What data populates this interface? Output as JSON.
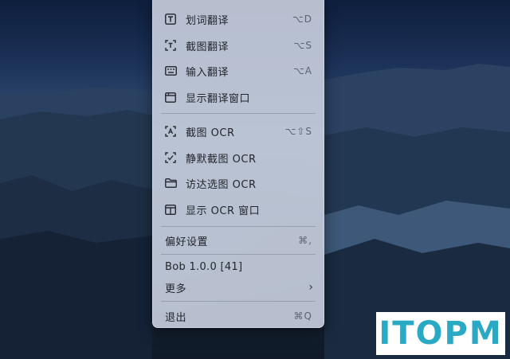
{
  "menu": {
    "items": [
      {
        "label": "划词翻译",
        "shortcut": "⌥D",
        "icon": "text-box-icon"
      },
      {
        "label": "截图翻译",
        "shortcut": "⌥S",
        "icon": "screenshot-text-icon"
      },
      {
        "label": "输入翻译",
        "shortcut": "⌥A",
        "icon": "keyboard-icon"
      },
      {
        "label": "显示翻译窗口",
        "shortcut": "",
        "icon": "window-icon"
      },
      {
        "label": "截图 OCR",
        "shortcut": "⌥⇧S",
        "icon": "screenshot-ocr-icon"
      },
      {
        "label": "静默截图 OCR",
        "shortcut": "",
        "icon": "silent-screenshot-icon"
      },
      {
        "label": "访达选图 OCR",
        "shortcut": "",
        "icon": "folder-icon"
      },
      {
        "label": "显示 OCR 窗口",
        "shortcut": "",
        "icon": "ocr-window-icon"
      },
      {
        "label": "偏好设置",
        "shortcut": "⌘,"
      },
      {
        "label": "更多",
        "shortcut": "›"
      },
      {
        "label": "退出",
        "shortcut": "⌘Q"
      }
    ],
    "version": "Bob 1.0.0 [41]"
  },
  "watermark": {
    "text": "ITOPM",
    "color": "#2aa9c4"
  }
}
